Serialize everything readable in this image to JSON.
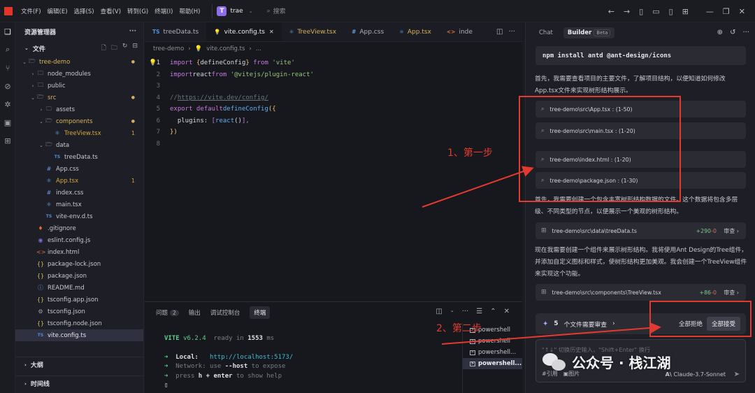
{
  "titlebar": {
    "menus": [
      "文件(F)",
      "编辑(E)",
      "选择(S)",
      "查看(V)",
      "转到(G)",
      "终端(I)",
      "帮助(H)"
    ],
    "project_initial": "T",
    "project_name": "trae",
    "search_placeholder": "搜索"
  },
  "sidebar": {
    "title": "资源管理器",
    "files_section": "文件",
    "outline_section": "大纲",
    "timeline_section": "时间线",
    "tree": [
      {
        "name": "tree-demo",
        "kind": "folder-open",
        "depth": 0,
        "color": "#d6b25a",
        "badge": "●"
      },
      {
        "name": "node_modules",
        "kind": "folder",
        "depth": 1,
        "color": "#c6c6cf",
        "badge": ""
      },
      {
        "name": "public",
        "kind": "folder",
        "depth": 1,
        "color": "#c6c6cf",
        "badge": ""
      },
      {
        "name": "src",
        "kind": "folder-open",
        "depth": 1,
        "color": "#d6b25a",
        "badge": "●"
      },
      {
        "name": "assets",
        "kind": "folder",
        "depth": 2,
        "color": "#c6c6cf",
        "badge": ""
      },
      {
        "name": "components",
        "kind": "folder-open",
        "depth": 2,
        "color": "#d6b25a",
        "badge": "●"
      },
      {
        "name": "TreeView.tsx",
        "kind": "tsx",
        "depth": 3,
        "color": "#d4a43a",
        "badge": "1"
      },
      {
        "name": "data",
        "kind": "folder-open",
        "depth": 2,
        "color": "#c6c6cf",
        "badge": ""
      },
      {
        "name": "treeData.ts",
        "kind": "ts",
        "depth": 3,
        "color": "#c6c6cf",
        "badge": ""
      },
      {
        "name": "App.css",
        "kind": "css",
        "depth": 2,
        "color": "#c6c6cf",
        "badge": ""
      },
      {
        "name": "App.tsx",
        "kind": "tsx",
        "depth": 2,
        "color": "#d4a43a",
        "badge": "1"
      },
      {
        "name": "index.css",
        "kind": "css",
        "depth": 2,
        "color": "#c6c6cf",
        "badge": ""
      },
      {
        "name": "main.tsx",
        "kind": "tsx",
        "depth": 2,
        "color": "#c6c6cf",
        "badge": ""
      },
      {
        "name": "vite-env.d.ts",
        "kind": "ts",
        "depth": 2,
        "color": "#c6c6cf",
        "badge": ""
      },
      {
        "name": ".gitignore",
        "kind": "git",
        "depth": 1,
        "color": "#c6c6cf",
        "badge": ""
      },
      {
        "name": "eslint.config.js",
        "kind": "eslint",
        "depth": 1,
        "color": "#c6c6cf",
        "badge": ""
      },
      {
        "name": "index.html",
        "kind": "html",
        "depth": 1,
        "color": "#c6c6cf",
        "badge": ""
      },
      {
        "name": "package-lock.json",
        "kind": "json",
        "depth": 1,
        "color": "#c6c6cf",
        "badge": ""
      },
      {
        "name": "package.json",
        "kind": "json",
        "depth": 1,
        "color": "#c6c6cf",
        "badge": ""
      },
      {
        "name": "README.md",
        "kind": "info",
        "depth": 1,
        "color": "#c6c6cf",
        "badge": ""
      },
      {
        "name": "tsconfig.app.json",
        "kind": "json",
        "depth": 1,
        "color": "#c6c6cf",
        "badge": ""
      },
      {
        "name": "tsconfig.json",
        "kind": "gear",
        "depth": 1,
        "color": "#c6c6cf",
        "badge": ""
      },
      {
        "name": "tsconfig.node.json",
        "kind": "json",
        "depth": 1,
        "color": "#c6c6cf",
        "badge": ""
      },
      {
        "name": "vite.config.ts",
        "kind": "ts",
        "depth": 1,
        "color": "#e6e6ec",
        "badge": "",
        "selected": true
      }
    ]
  },
  "editor": {
    "tabs": [
      {
        "label": "treeData.ts",
        "icon": "TS",
        "active": false,
        "modified": false
      },
      {
        "label": "vite.config.ts",
        "icon": "💡",
        "active": true,
        "modified": false
      },
      {
        "label": "TreeView.tsx",
        "icon": "⚛",
        "active": false,
        "modified": true
      },
      {
        "label": "App.css",
        "icon": "#",
        "active": false,
        "modified": false
      },
      {
        "label": "App.tsx",
        "icon": "⚛",
        "active": false,
        "modified": true
      },
      {
        "label": "inde",
        "icon": "<>",
        "active": false,
        "modified": false
      }
    ],
    "breadcrumb": [
      "tree-demo",
      "vite.config.ts",
      "..."
    ],
    "line_numbers": [
      "1",
      "2",
      "3",
      "4",
      "5",
      "6",
      "7",
      "8"
    ]
  },
  "code": {
    "l1_import": "import",
    "l1_open": "{",
    "l1_name": " defineConfig ",
    "l1_close": "}",
    "l1_from": "from",
    "l1_str": "'vite'",
    "l2_import": "import",
    "l2_name": " react ",
    "l2_from": "from",
    "l2_str": "'@vitejs/plugin-react'",
    "l4_comment": "// ",
    "l4_url": "https://vite.dev/config/",
    "l5_export": "export default",
    "l5_fn": " defineConfig",
    "l5_open": "({",
    "l6_key": "  plugins: ",
    "l6_open": "[",
    "l6_fn": "react",
    "l6_paren": "()",
    "l6_close": "],",
    "l7_close": "})"
  },
  "panel": {
    "tabs": [
      {
        "label": "问题",
        "count": "2",
        "active": false
      },
      {
        "label": "输出",
        "count": "",
        "active": false
      },
      {
        "label": "调试控制台",
        "count": "",
        "active": false
      },
      {
        "label": "终端",
        "count": "",
        "active": true
      }
    ],
    "terminal": {
      "vite": "VITE",
      "version": "v6.2.4",
      "ready": "ready in",
      "ms_value": "1553",
      "ms_unit": "ms",
      "local_label": "Local:",
      "local_url": "http://localhost:5173/",
      "network_label": "Network:",
      "network_text": "use",
      "network_flag": "--host",
      "network_tail": "to expose",
      "help_text": "press",
      "help_key": "h + enter",
      "help_tail": "to show help"
    },
    "terminals": [
      "powershell",
      "powershell",
      "powershell...",
      "powershell..."
    ]
  },
  "chat": {
    "tabs": [
      {
        "label": "Chat",
        "active": false
      },
      {
        "label": "Builder",
        "active": true
      }
    ],
    "beta": "Beta",
    "command": "npm install antd @ant-design/icons",
    "intro_text": "首先，我需要查看项目的主要文件，了解项目结构，以便知道如何修改App.tsx文件来实现树形结构展示。",
    "read_files": [
      "tree-demo\\src\\App.tsx : (1-50)",
      "tree-demo\\src\\main.tsx : (1-20)",
      "tree-demo\\index.html : (1-20)",
      "tree-demo\\package.json : (1-30)"
    ],
    "data_text": "首先，我需要创建一个包含丰富树形结构数据的文件。这个数据将包含多层级、不同类型的节点，以便展示一个美观的树形结构。",
    "change1": {
      "path": "tree-demo\\src\\data\\treeData.ts",
      "adds": "+290",
      "dels": "-0",
      "review": "审查 ›"
    },
    "component_text": "现在我需要创建一个组件来展示树形结构。我将使用Ant Design的Tree组件，并添加自定义图标和样式，使树形结构更加美观。我会创建一个TreeView组件来实现这个功能。",
    "change2": {
      "path": "tree-demo\\src\\components\\TreeView.tsx",
      "adds": "+86",
      "dels": "-0",
      "review": "审查 ›"
    },
    "review_count": "5",
    "review_label": "个文件需要审查",
    "reject_all": "全部拒绝",
    "accept_all": "全部接受",
    "input_placeholder": "\"↑↓\" 切换历史输入，\"Shift+Enter\" 换行",
    "ref_label": "#引用",
    "image_label": "图片",
    "model_label": "Claude-3.7-Sonnet"
  },
  "annotations": {
    "step1": "1、第一步",
    "step2": "2、第二步",
    "color": "#e23a2f"
  },
  "watermark": {
    "text": "公众号 · 栈江湖"
  }
}
